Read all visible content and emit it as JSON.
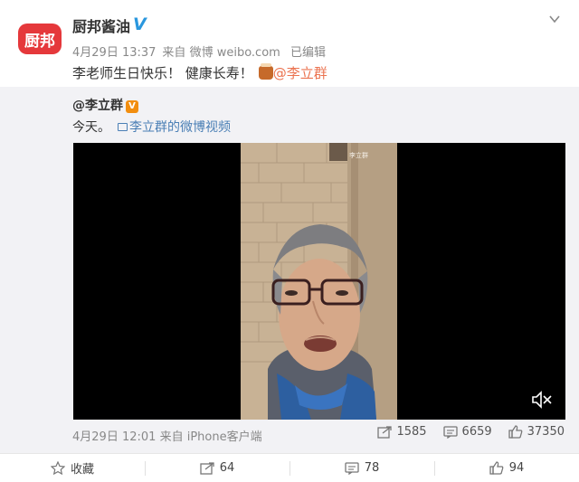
{
  "post": {
    "avatar_text": "厨邦",
    "author": "厨邦酱油",
    "verified_mark": "V",
    "date": "4月29日 13:37",
    "source_prefix": "来自",
    "source": "微博 weibo.com",
    "edited": "已编辑",
    "text": "李老师生日快乐！ 健康长寿！",
    "mention": "@李立群"
  },
  "quote": {
    "author": "@李立群",
    "badge": "V",
    "text": "今天。",
    "link": "李立群的微博视频",
    "video_watermark": "李立群",
    "date": "4月29日 12:01",
    "source_prefix": "来自",
    "source": "iPhone客户端",
    "reposts": "1585",
    "comments": "6659",
    "likes": "37350"
  },
  "footer": {
    "favorite": "收藏",
    "repost": "64",
    "comment": "78",
    "like": "94"
  },
  "colors": {
    "mention": "#eb7350",
    "link": "#4a7fb5",
    "verified": "#2a97de",
    "avatar_bg": "#e5383b"
  }
}
